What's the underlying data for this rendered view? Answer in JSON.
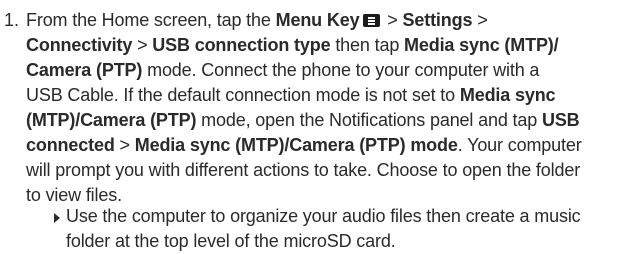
{
  "step": {
    "number": "1.",
    "lines": [
      {
        "t1": "From the Home screen, tap the ",
        "b1": "Menu Key",
        "t2": " > ",
        "b2": "Settings",
        "t3": " >"
      },
      {
        "b1": "Connectivity",
        "t1": " > ",
        "b2": "USB connection type",
        "t2": " then tap ",
        "b3": "Media sync (MTP)/"
      },
      {
        "b1": "Camera (PTP)",
        "t1": " mode. Connect the phone to your computer with a"
      },
      {
        "t1": "USB Cable. If the default connection mode is not set to ",
        "b1": "Media sync"
      },
      {
        "b1": "(MTP)/Camera (PTP)",
        "t1": " mode, open the Notifications panel and tap ",
        "b2": "USB"
      },
      {
        "b1": "connected",
        "t1": " > ",
        "b2": "Media sync (MTP)/Camera (PTP) mode",
        "t2": ". Your computer"
      },
      {
        "t1": "will prompt you with different actions to take. Choose to open the folder"
      },
      {
        "t1": "to view files."
      }
    ]
  },
  "bullet": {
    "lines": [
      "Use the computer to organize your audio files then create a music",
      "folder at the top level of the microSD card."
    ]
  },
  "icons": {
    "menu_key": "menu-key-icon",
    "bullet": "triangle-bullet-icon"
  }
}
